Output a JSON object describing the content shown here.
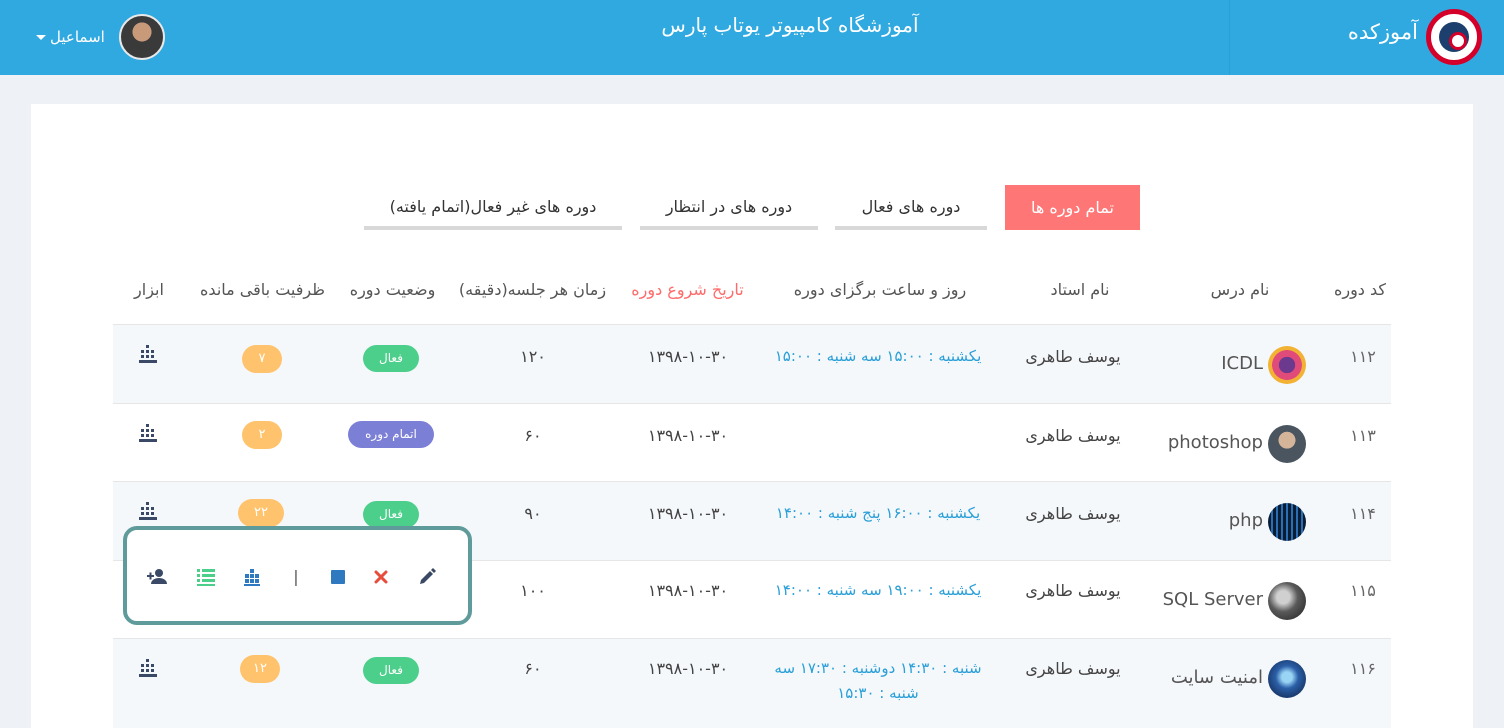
{
  "header": {
    "brand": "آموزکده",
    "title": "آموزشگاه کامپیوتر یوتاب پارس",
    "user_name": "اسماعیل"
  },
  "tabs": [
    {
      "label": "تمام دوره ها",
      "active": true
    },
    {
      "label": "دوره های فعال",
      "active": false
    },
    {
      "label": "دوره های در انتظار",
      "active": false
    },
    {
      "label": "دوره های غیر فعال(اتمام یافته)",
      "active": false
    }
  ],
  "table": {
    "headers": {
      "code": "کد دوره",
      "course": "نام درس",
      "teacher": "نام استاد",
      "schedule": "روز و ساعت برگزای دوره",
      "start": "تاریخ شروع دوره",
      "duration": "زمان هر جلسه(دقیقه)",
      "status": "وضعیت دوره",
      "capacity": "ظرفیت باقی مانده",
      "tools": "ابزار"
    },
    "rows": [
      {
        "code": "۱۱۲",
        "course": "ICDL",
        "teacher": "یوسف طاهری",
        "schedule_line1": "یکشنبه : ۱۵:۰۰ سه شنبه : ۱۵:۰۰",
        "schedule_line2": "",
        "start": "۱۳۹۸-۱۰-۳۰",
        "duration": "۱۲۰",
        "status": "فعال",
        "capacity": "۷"
      },
      {
        "code": "۱۱۳",
        "course": "photoshop",
        "teacher": "یوسف طاهری",
        "schedule_line1": "",
        "schedule_line2": "",
        "start": "۱۳۹۸-۱۰-۳۰",
        "duration": "۶۰",
        "status": "اتمام دوره",
        "capacity": "۲"
      },
      {
        "code": "۱۱۴",
        "course": "php",
        "teacher": "یوسف طاهری",
        "schedule_line1": "یکشنبه : ۱۶:۰۰ پنج شنبه : ۱۴:۰۰",
        "schedule_line2": "",
        "start": "۱۳۹۸-۱۰-۳۰",
        "duration": "۹۰",
        "status": "فعال",
        "capacity": "۲۲"
      },
      {
        "code": "۱۱۵",
        "course": "SQL Server",
        "teacher": "یوسف طاهری",
        "schedule_line1": "یکشنبه : ۱۹:۰۰ سه شنبه : ۱۴:۰۰",
        "schedule_line2": "",
        "start": "۱۳۹۸-۱۰-۳۰",
        "duration": "۱۰۰",
        "status": "",
        "capacity": ""
      },
      {
        "code": "۱۱۶",
        "course": "امنیت سایت",
        "teacher": "یوسف طاهری",
        "schedule_line1": "شنبه : ۱۴:۳۰ دوشنبه : ۱۷:۳۰ سه",
        "schedule_line2": "شنبه : ۱۵:۳۰",
        "start": "۱۳۹۸-۱۰-۳۰",
        "duration": "۶۰",
        "status": "فعال",
        "capacity": "۱۲"
      }
    ]
  },
  "icons": {
    "tools": "chart-icon",
    "popup": [
      "add-user-icon",
      "list-icon",
      "chart-icon",
      "separator",
      "stop-icon",
      "close-icon",
      "edit-icon"
    ]
  },
  "colors": {
    "header": "#2fa9e0",
    "active_tab": "#ff7676",
    "active_badge": "#4ccf8b",
    "done_badge": "#7c7fd6",
    "capacity_badge": "#ffc36d",
    "popup_border": "#5e9b9a",
    "schedule_text": "#2a9fd8"
  }
}
